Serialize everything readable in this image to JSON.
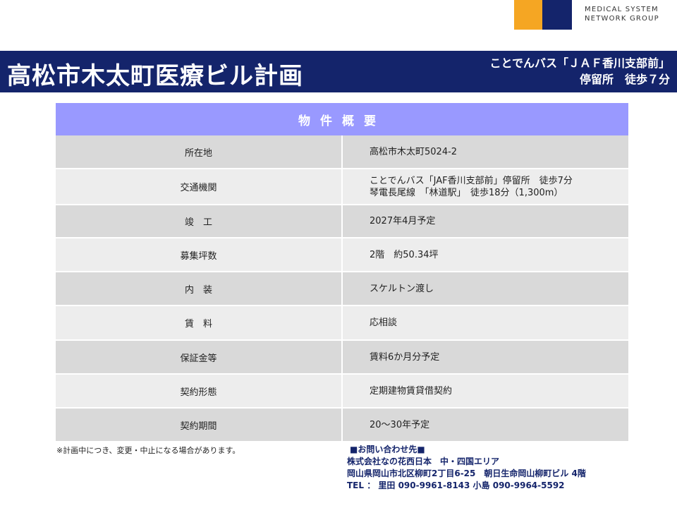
{
  "logo": {
    "line1": "MEDICAL SYSTEM",
    "line2": "NETWORK GROUP",
    "colors": {
      "orange": "#f5a623",
      "navy": "#14246b"
    }
  },
  "header": {
    "title": "高松市木太町医療ビル計画",
    "access_line1": "ことでんバス「ＪＡＦ香川支部前」",
    "access_line2": "停留所　徒歩７分"
  },
  "table": {
    "heading": "物件概要",
    "rows": [
      {
        "label": "所在地",
        "value": [
          "高松市木太町5024-2"
        ]
      },
      {
        "label": "交通機関",
        "value": [
          "ことでんバス「JAF香川支部前」停留所　徒歩7分",
          "琴電長尾線　「林道駅」　徒歩18分（1,300m）"
        ]
      },
      {
        "label": "竣　工",
        "value": [
          "2027年4月予定"
        ]
      },
      {
        "label": "募集坪数",
        "value": [
          "2階　約50.34坪"
        ]
      },
      {
        "label": "内　装",
        "value": [
          "スケルトン渡し"
        ]
      },
      {
        "label": "賃　料",
        "value": [
          "応相談"
        ]
      },
      {
        "label": "保証金等",
        "value": [
          "賃料6か月分予定"
        ]
      },
      {
        "label": "契約形態",
        "value": [
          "定期建物賃貸借契約"
        ]
      },
      {
        "label": "契約期間",
        "value": [
          "20～30年予定"
        ]
      }
    ]
  },
  "note": "※計画中につき、変更・中止になる場合があります。",
  "contact": {
    "heading": "■お問い合わせ先■",
    "company": "株式会社なの花西日本　中・四国エリア",
    "address": "岡山県岡山市北区柳町2丁目6-25　朝日生命岡山柳町ビル 4階",
    "tel": "TEL ： 里田 090-9961-8143 小島 090-9964-5592"
  }
}
